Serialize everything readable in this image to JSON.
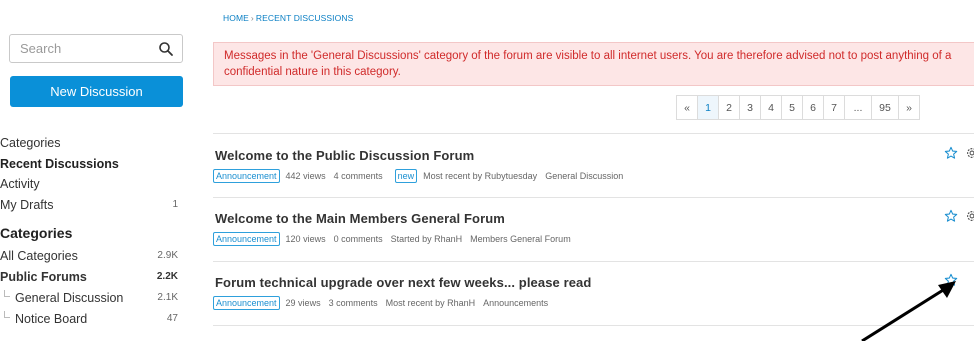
{
  "search": {
    "placeholder": "Search"
  },
  "new_discussion_label": "New Discussion",
  "nav": [
    {
      "label": "Categories",
      "count": ""
    },
    {
      "label": "Recent Discussions",
      "count": ""
    },
    {
      "label": "Activity",
      "count": ""
    },
    {
      "label": "My Drafts",
      "count": "1"
    }
  ],
  "categories_heading": "Categories",
  "categories": [
    {
      "label": "All Categories",
      "count": "2.9K"
    },
    {
      "label": "Public Forums",
      "count": "2.2K"
    },
    {
      "label": "General Discussion",
      "count": "2.1K"
    },
    {
      "label": "Notice Board",
      "count": "47"
    }
  ],
  "breadcrumb": {
    "home": "HOME",
    "separator": "›",
    "current": "RECENT DISCUSSIONS"
  },
  "alert": "Messages in the 'General Discussions' category of the forum are visible to all internet users. You are therefore advised not to post anything of a confidential nature in this category.",
  "pager": [
    "«",
    "1",
    "2",
    "3",
    "4",
    "5",
    "6",
    "7",
    "...",
    "95",
    "»"
  ],
  "discussions": [
    {
      "title": "Welcome to the Public Discussion Forum",
      "tag": "Announcement",
      "views": "442 views",
      "comments": "4 comments",
      "new_badge": "new",
      "activity": "Most recent by Rubytuesday",
      "category": "General Discussion"
    },
    {
      "title": "Welcome to the Main Members General Forum",
      "tag": "Announcement",
      "views": "120 views",
      "comments": "0 comments",
      "activity": "Started by RhanH",
      "category": "Members General Forum"
    },
    {
      "title": "Forum technical upgrade over next few weeks... please read",
      "tag": "Announcement",
      "views": "29 views",
      "comments": "3 comments",
      "activity": "Most recent by RhanH",
      "category": "Announcements"
    }
  ],
  "colors": {
    "accent": "#0a90d8",
    "alert_bg": "#fde6e6",
    "alert_text": "#d02a2a",
    "link": "#0a7fc4"
  },
  "icons": [
    "search-icon",
    "star-icon",
    "gear-icon",
    "sub-category-marker-icon"
  ]
}
